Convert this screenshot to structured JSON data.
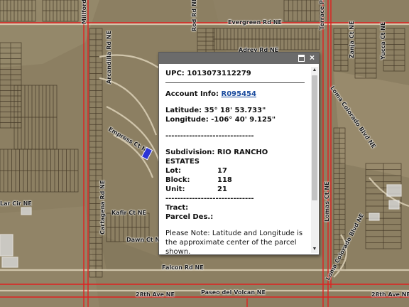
{
  "map": {
    "streets": [
      "Evergreen Rd NE",
      "Adrey Rd NE",
      "Rod Rd NE",
      "Terrace Pl",
      "Loma Colorado Blvd NE",
      "Zanja Ct NE",
      "Yucca Ct NE",
      "Arcandilla Rd NE",
      "Empress Ct NE",
      "Kafir Ct NE",
      "Dawn Ct NE",
      "Falcon Rd NE",
      "Cartagena Rd NE",
      "Paseo del Volcan NE",
      "28th Ave NE",
      "Lar Cir NE",
      "Lomas Ct NE",
      "Millford"
    ],
    "colors": {
      "parcel_line": "#3a2f1f",
      "boundary": "#e02020",
      "highlight": "#2b35d6"
    }
  },
  "popup": {
    "upc_label": "UPC:",
    "upc_value": "1013073112279",
    "account_label": "Account Info:",
    "account_link": "R095454",
    "latitude_label": "Latitude:",
    "latitude_value": "35° 18' 53.733\"",
    "longitude_label": "Longitude:",
    "longitude_value": "-106° 40' 9.125\"",
    "separator": "------------------------------",
    "subdivision_label": "Subdivision:",
    "subdivision_value": "RIO RANCHO",
    "subdivision_value2": "ESTATES",
    "lot_label": "Lot:",
    "lot_value": "17",
    "block_label": "Block:",
    "block_value": "118",
    "unit_label": "Unit:",
    "unit_value": "21",
    "tract_label": "Tract:",
    "parcel_des_label": "Parcel Des.:",
    "note": "Please Note: Latitude and Longitude is the approximate center of the parcel shown."
  }
}
